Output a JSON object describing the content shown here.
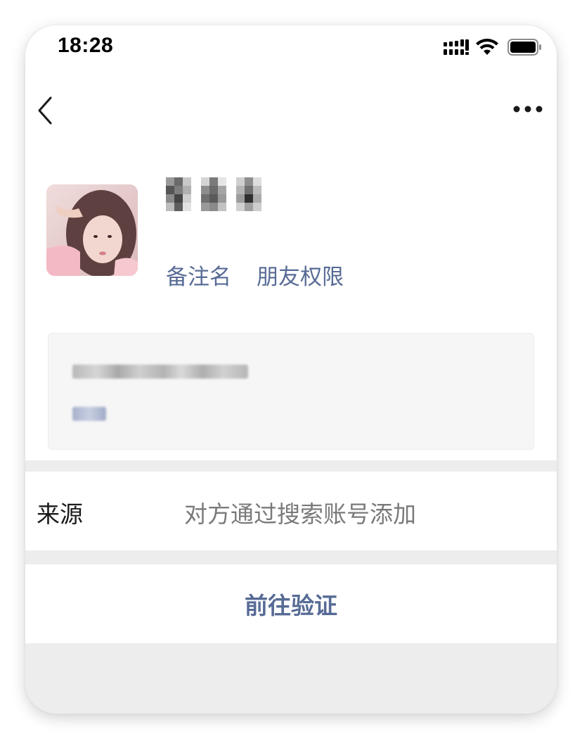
{
  "status_bar": {
    "time": "18:28",
    "icons": [
      "signal-icon",
      "wifi-icon",
      "battery-icon"
    ]
  },
  "nav": {
    "back_icon": "chevron-left-icon",
    "more_icon": "more-dots-icon"
  },
  "profile": {
    "remark_link": "备注名",
    "permission_link": "朋友权限"
  },
  "source": {
    "label": "来源",
    "value": "对方通过搜索账号添加"
  },
  "actions": {
    "verify_label": "前往验证"
  },
  "colors": {
    "link_blue": "#576b95",
    "background_gray": "#ededed",
    "card_gray": "#f6f6f6",
    "text_dark": "#1a1a1a",
    "text_gray": "#7a7a7a"
  }
}
